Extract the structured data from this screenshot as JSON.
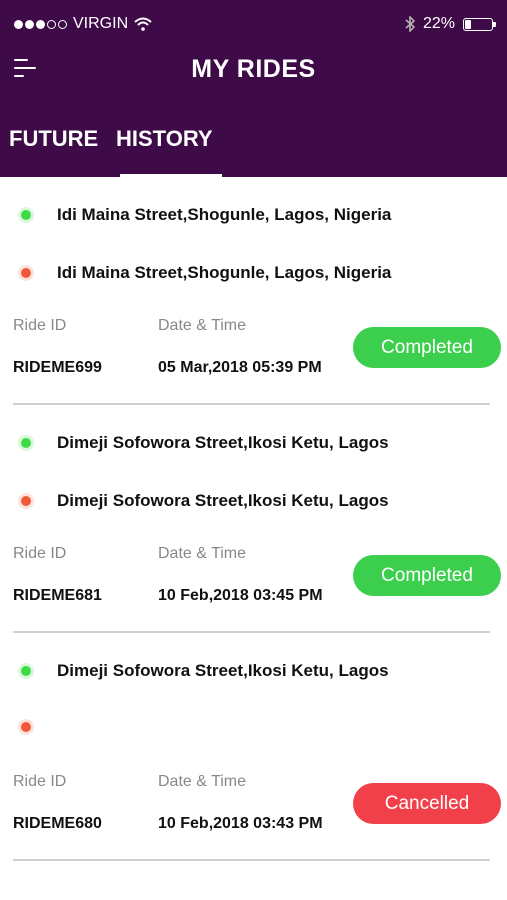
{
  "status_bar": {
    "carrier": "VIRGIN",
    "battery": "22%"
  },
  "header": {
    "title": "MY RIDES"
  },
  "tabs": [
    {
      "label": "FUTURE"
    },
    {
      "label": "HISTORY"
    }
  ],
  "labels": {
    "ride_id": "Ride ID",
    "date_time": "Date & Time"
  },
  "rides": [
    {
      "pickup": "Idi Maina Street,Shogunle, Lagos, Nigeria",
      "drop": "Idi Maina Street,Shogunle, Lagos, Nigeria",
      "ride_id": "RIDEME699",
      "date_time": "05 Mar,2018 05:39 PM",
      "status": "Completed"
    },
    {
      "pickup": "Dimeji Sofowora Street,Ikosi Ketu, Lagos",
      "drop": "Dimeji Sofowora Street,Ikosi Ketu, Lagos",
      "ride_id": "RIDEME681",
      "date_time": "10 Feb,2018 03:45 PM",
      "status": "Completed"
    },
    {
      "pickup": "Dimeji Sofowora Street,Ikosi Ketu, Lagos",
      "drop": "",
      "ride_id": "RIDEME680",
      "date_time": "10 Feb,2018 03:43 PM",
      "status": "Cancelled"
    }
  ],
  "colors": {
    "header_bg": "#3e0a47",
    "completed": "#3ccf4e",
    "cancelled": "#f2404a",
    "pickup_dot": "#3ddc46",
    "drop_dot": "#f05a3a"
  }
}
